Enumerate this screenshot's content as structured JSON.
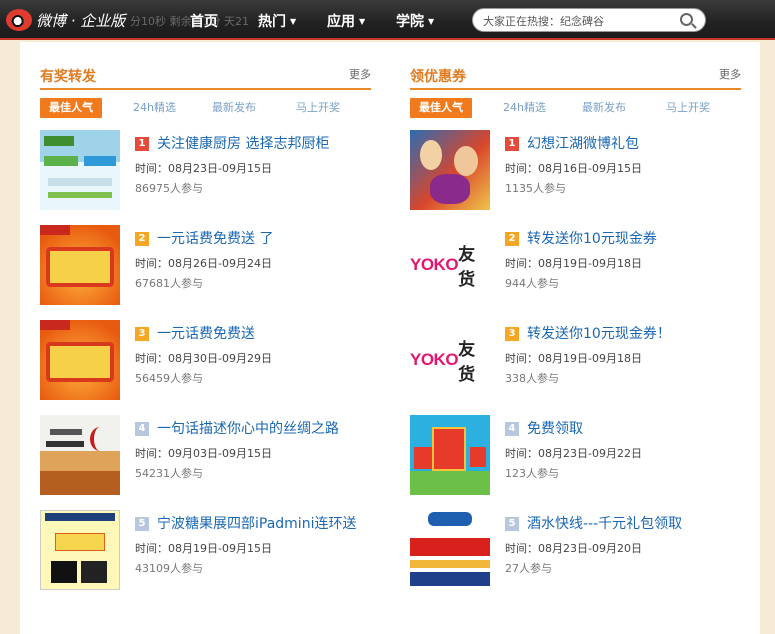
{
  "topbar": {
    "logo_text": "微博 · 企业版",
    "ticker_text": "分10秒    剩余：1分    天21",
    "nav": [
      {
        "label": "首页",
        "has_caret": false
      },
      {
        "label": "热门",
        "has_caret": true
      },
      {
        "label": "应用",
        "has_caret": true
      },
      {
        "label": "学院",
        "has_caret": true
      }
    ],
    "search_text": "大家正在热搜：纪念碑谷"
  },
  "left": {
    "title": "有奖转发",
    "more": "更多",
    "tabs": [
      "最佳人气",
      "24h精选",
      "最新发布",
      "马上开奖"
    ],
    "items": [
      {
        "rank": "1",
        "title": "关注健康厨房 选择志邦厨柜",
        "time": "时间：08月23日-09月15日",
        "count": "86975人参与"
      },
      {
        "rank": "2",
        "title": "一元话费免费送 了",
        "time": "时间：08月26日-09月24日",
        "count": "67681人参与"
      },
      {
        "rank": "3",
        "title": "一元话费免费送",
        "time": "时间：08月30日-09月29日",
        "count": "56459人参与"
      },
      {
        "rank": "4",
        "title": "一句话描述你心中的丝绸之路",
        "time": "时间：09月03日-09月15日",
        "count": "54231人参与"
      },
      {
        "rank": "5",
        "title": "宁波糖果展四部iPadmini连环送",
        "time": "时间：08月19日-09月15日",
        "count": "43109人参与"
      }
    ]
  },
  "right": {
    "title": "领优惠券",
    "more": "更多",
    "tabs": [
      "最佳人气",
      "24h精选",
      "最新发布",
      "马上开奖"
    ],
    "items": [
      {
        "rank": "1",
        "title": "幻想江湖微博礼包",
        "time": "时间：08月16日-09月15日",
        "count": "1135人参与"
      },
      {
        "rank": "2",
        "title": "转发送你10元现金券",
        "time": "时间：08月19日-09月18日",
        "count": "944人参与"
      },
      {
        "rank": "3",
        "title": "转发送你10元现金券！",
        "time": "时间：08月19日-09月18日",
        "count": "338人参与"
      },
      {
        "rank": "4",
        "title": "免费领取",
        "time": "时间：08月23日-09月22日",
        "count": "123人参与"
      },
      {
        "rank": "5",
        "title": "酒水快线---千元礼包领取",
        "time": "时间：08月23日-09月20日",
        "count": "27人参与"
      }
    ],
    "yoko_word": "YOKO",
    "yoko_cn": "友货"
  },
  "colors": {
    "accent": "#e88a2a",
    "tab_active": "#f07a1c",
    "link": "#1a67b4",
    "rank_top": "#e64a3a",
    "rank_mid": "#f5a623",
    "rank_low": "#b7c7dd"
  }
}
